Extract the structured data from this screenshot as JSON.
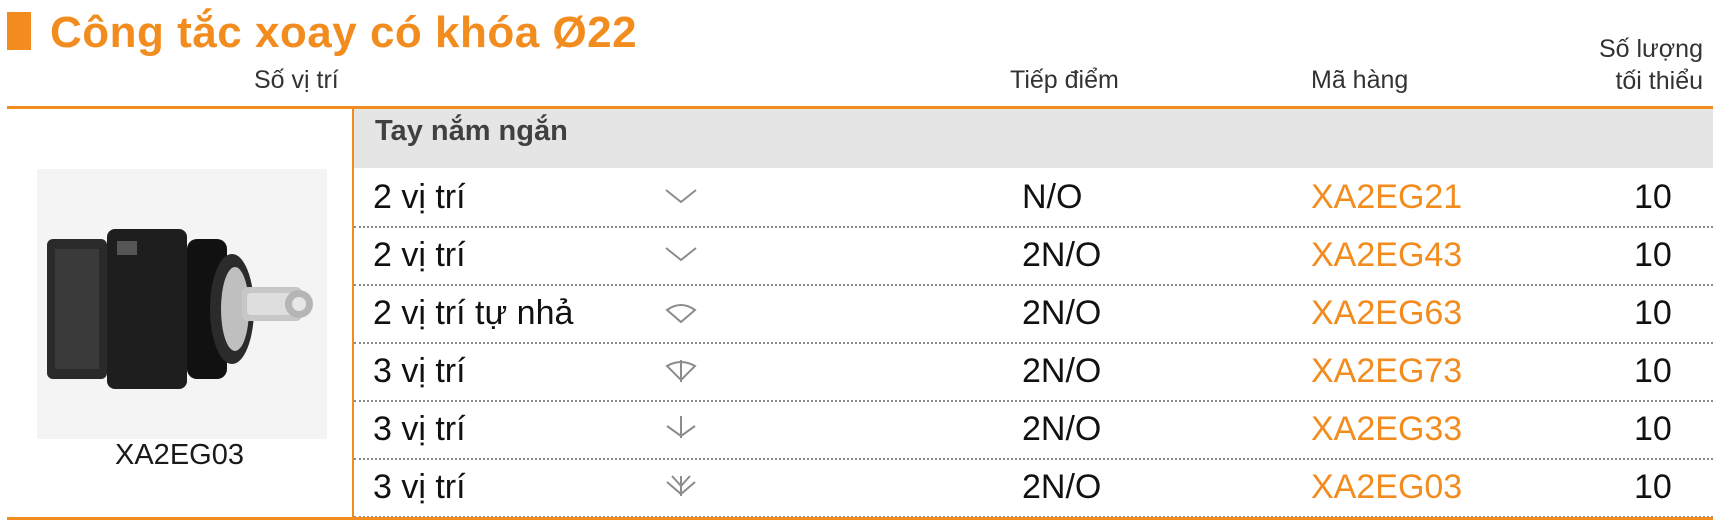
{
  "title": "Công tắc xoay có khóa Ø22",
  "colors": {
    "accent": "#f28c1e",
    "section_bg": "#e5e5e5"
  },
  "headers": {
    "positions": "Số vị trí",
    "contacts": "Tiếp điểm",
    "code": "Mã hàng",
    "min_qty_line1": "Số lượng",
    "min_qty_line2": "tối thiểu"
  },
  "product": {
    "image": "rotary-key-switch-image",
    "code": "XA2EG03"
  },
  "section": {
    "label": "Tay nắm ngắn"
  },
  "rows": [
    {
      "positions": "2 vị trí",
      "icon": "two-position-icon",
      "contacts": "N/O",
      "code": "XA2EG21",
      "qty": "10"
    },
    {
      "positions": "2 vị trí",
      "icon": "two-position-icon",
      "contacts": "2N/O",
      "code": "XA2EG43",
      "qty": "10"
    },
    {
      "positions": "2 vị trí tự nhả",
      "icon": "spring-return-icon",
      "contacts": "2N/O",
      "code": "XA2EG63",
      "qty": "10"
    },
    {
      "positions": "3 vị trí",
      "icon": "three-position-spring-icon",
      "contacts": "2N/O",
      "code": "XA2EG73",
      "qty": "10"
    },
    {
      "positions": "3 vị trí",
      "icon": "three-position-icon",
      "contacts": "2N/O",
      "code": "XA2EG33",
      "qty": "10"
    },
    {
      "positions": "3 vị trí",
      "icon": "three-position-icon",
      "contacts": "2N/O",
      "code": "XA2EG03",
      "qty": "10"
    }
  ]
}
